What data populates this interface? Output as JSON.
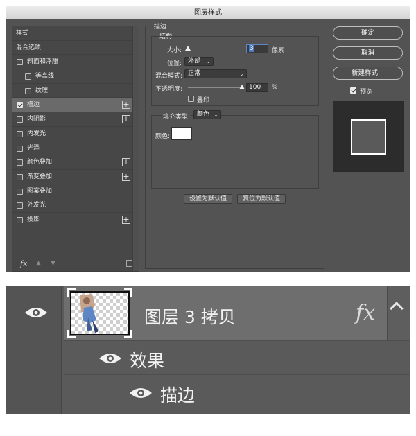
{
  "dialog": {
    "title": "图层样式",
    "styles": [
      {
        "label": "样式",
        "type": "header"
      },
      {
        "label": "混合选项",
        "type": "header"
      },
      {
        "label": "斜面和浮雕",
        "checked": false,
        "indent": 0,
        "plus": false
      },
      {
        "label": "等高线",
        "checked": false,
        "indent": 1,
        "plus": false
      },
      {
        "label": "纹理",
        "checked": false,
        "indent": 1,
        "plus": false
      },
      {
        "label": "描边",
        "checked": true,
        "indent": 0,
        "plus": true,
        "selected": true
      },
      {
        "label": "内阴影",
        "checked": false,
        "indent": 0,
        "plus": true
      },
      {
        "label": "内发光",
        "checked": false,
        "indent": 0,
        "plus": false
      },
      {
        "label": "光泽",
        "checked": false,
        "indent": 0,
        "plus": false
      },
      {
        "label": "颜色叠加",
        "checked": false,
        "indent": 0,
        "plus": true
      },
      {
        "label": "渐变叠加",
        "checked": false,
        "indent": 0,
        "plus": true
      },
      {
        "label": "图案叠加",
        "checked": false,
        "indent": 0,
        "plus": false
      },
      {
        "label": "外发光",
        "checked": false,
        "indent": 0,
        "plus": false
      },
      {
        "label": "投影",
        "checked": false,
        "indent": 0,
        "plus": true
      }
    ],
    "bottom_icons": {
      "fx": "fx",
      "up": "up-arrow-icon",
      "down": "down-arrow-icon",
      "trash": "trash-icon"
    },
    "stroke": {
      "section_title": "描边",
      "structure_title": "结构",
      "size_label": "大小:",
      "size_value": "3",
      "size_unit": "像素",
      "size_level_fraction": 0.04,
      "position_label": "位置:",
      "position_value": "外部",
      "blend_label": "混合模式:",
      "blend_value": "正常",
      "opacity_label": "不透明度:",
      "opacity_value": "100",
      "opacity_unit": "%",
      "opacity_level_fraction": 1.0,
      "overprint_label": "叠印",
      "overprint_checked": false,
      "fill_type_label": "填充类型:",
      "fill_type_value": "颜色",
      "color_label": "颜色:",
      "color_value": "#ffffff",
      "make_default": "设置为默认值",
      "reset_default": "复位为默认值"
    },
    "buttons": {
      "ok": "确定",
      "cancel": "取消",
      "new_style": "新建样式..."
    },
    "preview": {
      "label": "预览",
      "checked": true
    }
  },
  "layers": {
    "layer_name": "图层 3 拷贝",
    "fx_badge": "fx",
    "effects_label": "效果",
    "effect_item": "描边"
  },
  "colors": {
    "dialog_bg": "#535353",
    "selected_row": "#6a6a6a",
    "layer_row_bg": "#6e6e6e",
    "accent_blue": "#4d7ac0"
  }
}
